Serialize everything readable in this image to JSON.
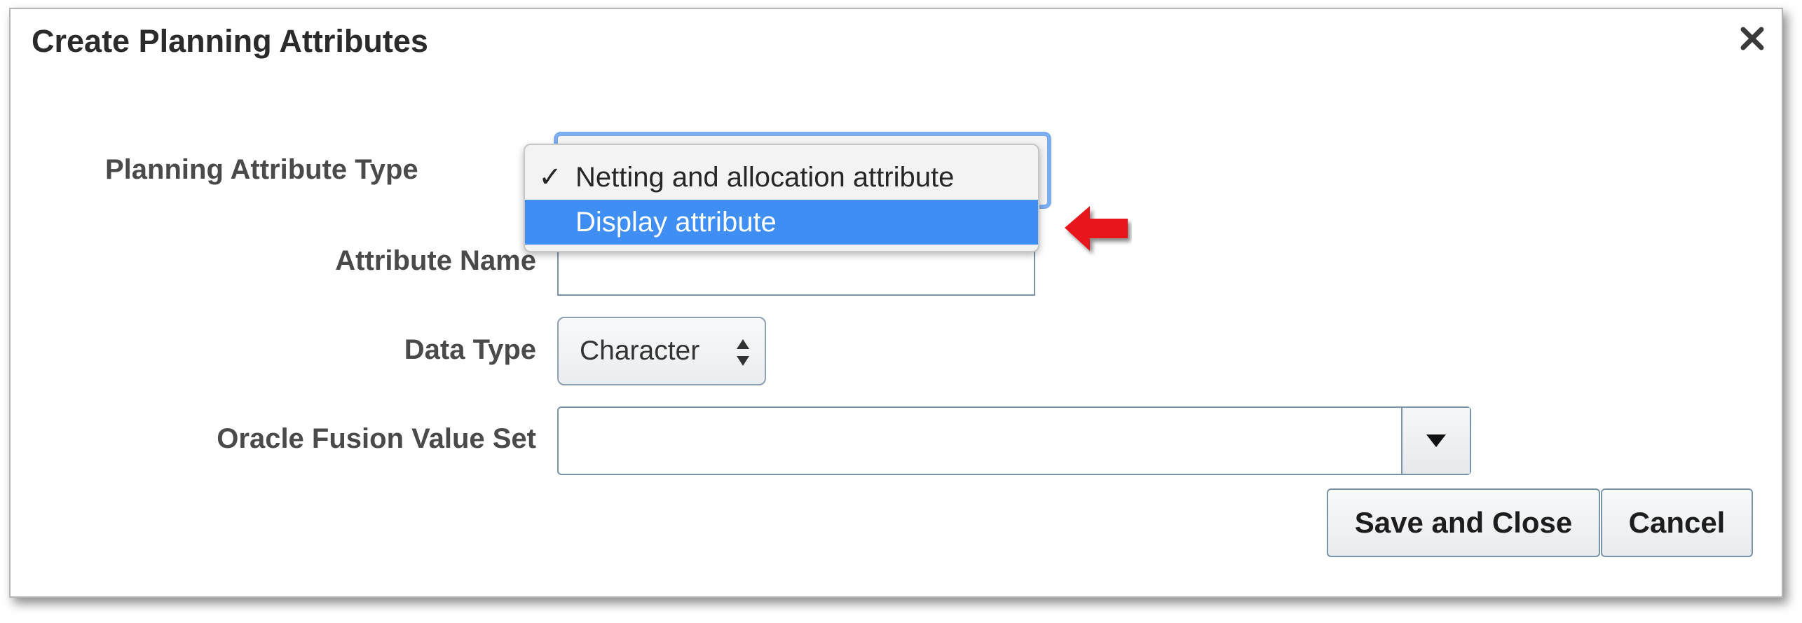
{
  "dialog": {
    "title": "Create Planning Attributes",
    "close_icon": "close-icon"
  },
  "form": {
    "planning_attribute_type_label": "Planning Attribute Type",
    "attribute_name_label": "Attribute Name",
    "attribute_name_value": "",
    "data_type_label": "Data Type",
    "data_type_value": "Character",
    "value_set_label": "Oracle Fusion Value Set",
    "value_set_value": ""
  },
  "dropdown": {
    "options": [
      {
        "label": "Netting and allocation attribute",
        "checked": true
      },
      {
        "label": "Display attribute",
        "highlighted": true
      }
    ],
    "checkmark": "✓"
  },
  "buttons": {
    "save_and_close": "Save and Close",
    "cancel": "Cancel"
  },
  "annotation": {
    "icon": "red-arrow-icon",
    "color": "#e8141a"
  },
  "colors": {
    "highlight": "#3f8ef4",
    "focus_ring": "#7aaef0",
    "border": "#7b93a9"
  }
}
